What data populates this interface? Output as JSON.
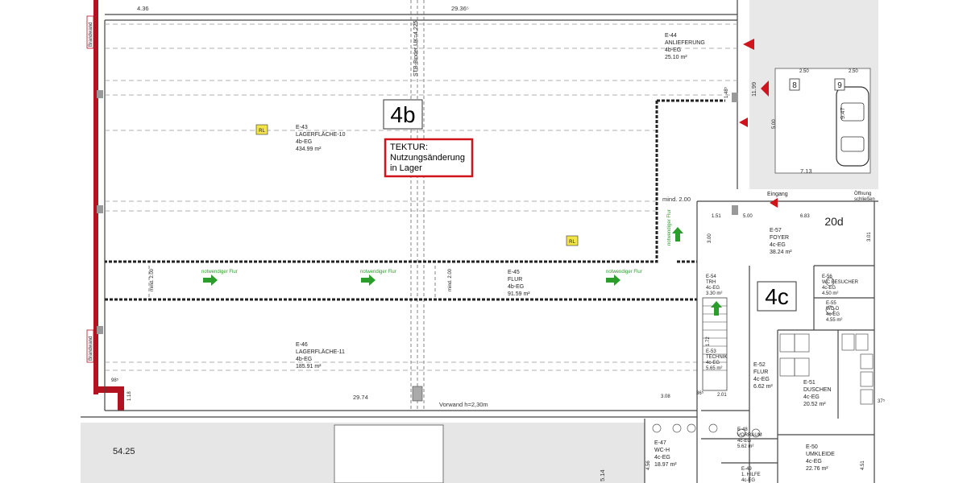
{
  "labels": {
    "block_4b": "4b",
    "block_4c": "4c",
    "tektur_line1": "TEKTUR:",
    "tektur_line2": "Nutzungsänderung",
    "tektur_line3": "in Lager",
    "binder": "STB-Binder UK=4.225",
    "brandwand_top": "Brandwand",
    "brandwand_bottom": "Brandwand",
    "vorwand": "Vorwand h=2,30m",
    "eingang": "Eingang",
    "oeffnung": "Öffnung",
    "oeffnung2": "schließen",
    "rl": "RL",
    "flur_note": "notwendiger Flur",
    "zone_20d": "20d",
    "fluchtweg": "Fluchtweg"
  },
  "rooms": {
    "e43": {
      "id": "E-43",
      "name": "LAGERFLÄCHE-10",
      "level": "4b-EG",
      "area": "434.99 m²"
    },
    "e44": {
      "id": "E-44",
      "name": "ANLIEFERUNG",
      "level": "4b-EG",
      "area": "25.10 m²"
    },
    "e45": {
      "id": "E-45",
      "name": "FLUR",
      "level": "4b-EG",
      "area": "91.59 m²"
    },
    "e46": {
      "id": "E-46",
      "name": "LAGERFLÄCHE-11",
      "level": "4b-EG",
      "area": "185.91 m²"
    },
    "e57": {
      "id": "E-57",
      "name": "FOYER",
      "level": "4c-EG",
      "area": "38.24 m²"
    },
    "e52": {
      "id": "E-52",
      "name": "FLUR",
      "level": "4c-EG",
      "area": "6.62 m²"
    },
    "e51": {
      "id": "E-51",
      "name": "DUSCHEN",
      "level": "4c-EG",
      "area": "20.52 m²"
    },
    "e50": {
      "id": "E-50",
      "name": "UMKLEIDE",
      "level": "4c-EG",
      "area": "22.76 m²"
    },
    "e47": {
      "id": "E-47",
      "name": "WC-H",
      "level": "4c-EG",
      "area": "18.97 m²"
    },
    "e48": {
      "id": "E-48",
      "name": "VORRAUM",
      "level": "4c-EG",
      "area": "5.62 m²"
    },
    "e49": {
      "id": "E-49",
      "name": "1. HILFE",
      "level": "4c-EG",
      "area": ""
    },
    "e53": {
      "id": "E-53",
      "name": "TECHNIK",
      "level": "4c-EG",
      "area": "5.65 m²"
    },
    "e54": {
      "id": "E-54",
      "name": "TRH",
      "level": "4c-EG",
      "area": "3.30 m²"
    },
    "e56": {
      "id": "E-56",
      "name": "WC BESUCHER",
      "level": "4c-EG",
      "area": "4.50 m²"
    },
    "e55": {
      "id": "E-55",
      "name": "WC-D",
      "level": "4c-EG",
      "area": "4.55 m²"
    }
  },
  "dimensions": {
    "d_436": "4.36",
    "d_2936": "29.36⁵",
    "d_1199": "11.99",
    "d_148": "1.48⁵",
    "d_500": "5.00",
    "d_947": "9.47",
    "d_713": "7.13",
    "d_250a": "2.50",
    "d_250b": "2.50",
    "d_min200": "mind. 2.00",
    "d_151": "1.51",
    "d_500b": "5.00",
    "d_683": "6.83",
    "d_300": "3.00",
    "d_301": "3.01",
    "d_min200b": "mind. 2.00",
    "d_min200c": "mind. 2.00",
    "d_2974": "29.74",
    "d_308": "3.08",
    "d_201": "2.01",
    "d_118": "1.18",
    "d_5425": "54.25",
    "d_514": "5.14",
    "d_456": "4.56",
    "d_451": "4.51",
    "d_98": "98⁵",
    "d_36": "36⁵",
    "d_37": "37⁵",
    "d_172": "1.72"
  },
  "parking": {
    "p8": "8",
    "p9": "9"
  },
  "colors": {
    "wall_red": "#b3121f",
    "arrow_green": "#2a9d2a",
    "tektur_red": "#d0141e",
    "rl_yellow": "#f3e44a"
  }
}
